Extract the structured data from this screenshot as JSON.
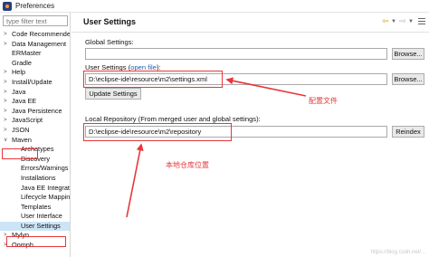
{
  "window": {
    "title": "Preferences"
  },
  "filter": {
    "placeholder": "type filter text"
  },
  "tree": {
    "items": [
      {
        "label": "Code Recommenders",
        "arrow": ">",
        "child": false
      },
      {
        "label": "Data Management",
        "arrow": ">",
        "child": false
      },
      {
        "label": "ERMaster",
        "arrow": "",
        "child": false
      },
      {
        "label": "Gradle",
        "arrow": "",
        "child": false
      },
      {
        "label": "Help",
        "arrow": ">",
        "child": false
      },
      {
        "label": "Install/Update",
        "arrow": ">",
        "child": false
      },
      {
        "label": "Java",
        "arrow": ">",
        "child": false
      },
      {
        "label": "Java EE",
        "arrow": ">",
        "child": false
      },
      {
        "label": "Java Persistence",
        "arrow": ">",
        "child": false
      },
      {
        "label": "JavaScript",
        "arrow": ">",
        "child": false
      },
      {
        "label": "JSON",
        "arrow": ">",
        "child": false
      },
      {
        "label": "Maven",
        "arrow": "v",
        "child": false
      },
      {
        "label": "Archetypes",
        "arrow": "",
        "child": true
      },
      {
        "label": "Discovery",
        "arrow": "",
        "child": true
      },
      {
        "label": "Errors/Warnings",
        "arrow": "",
        "child": true
      },
      {
        "label": "Installations",
        "arrow": "",
        "child": true
      },
      {
        "label": "Java EE Integration",
        "arrow": "",
        "child": true
      },
      {
        "label": "Lifecycle Mappings",
        "arrow": "",
        "child": true
      },
      {
        "label": "Templates",
        "arrow": "",
        "child": true
      },
      {
        "label": "User Interface",
        "arrow": "",
        "child": true
      },
      {
        "label": "User Settings",
        "arrow": "",
        "child": true,
        "selected": true
      },
      {
        "label": "Mylyn",
        "arrow": ">",
        "child": false
      },
      {
        "label": "Oomph",
        "arrow": ">",
        "child": false
      }
    ]
  },
  "page": {
    "title": "User Settings",
    "global_settings_label": "Global Settings:",
    "global_settings_value": "",
    "browse1": "Browse...",
    "user_settings_label": "User Settings (",
    "open_file_link": "open file",
    "user_settings_label_end": "):",
    "user_settings_value": "D:\\eclipse-ide\\resource\\m2\\settings.xml",
    "browse2": "Browse...",
    "update_settings": "Update Settings",
    "local_repo_label": "Local Repository (From merged user and global settings):",
    "local_repo_value": "D:\\eclipse-ide\\resource\\m2\\repository",
    "reindex": "Reindex"
  },
  "annotations": {
    "config_file": "配置文件",
    "local_repo": "本地仓库位置"
  },
  "watermark": "https://blog.csdn.net/...",
  "colors": {
    "highlight": "#e8363a",
    "selection": "#cce4f7",
    "link": "#1a5fb4"
  }
}
